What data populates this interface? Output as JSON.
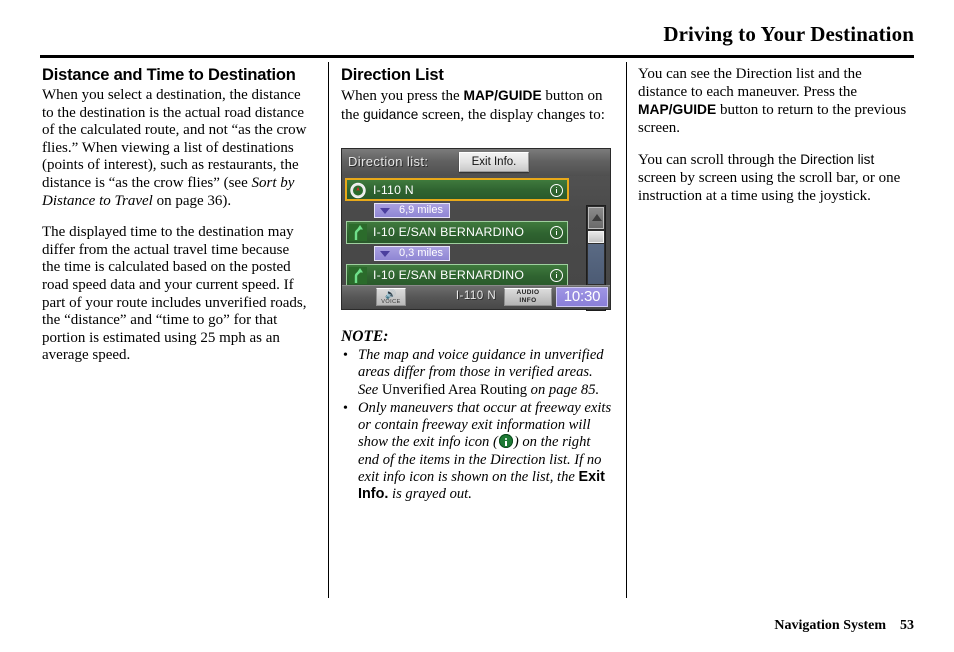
{
  "header": {
    "title": "Driving to Your Destination"
  },
  "footer": {
    "book_title": "Navigation System",
    "page_number": "53"
  },
  "column1": {
    "heading": "Distance and Time to Destination",
    "p1_a": "When you select a destination, the distance to the destination is the actual road distance of the calculated route, and not “as the crow flies.” When viewing a list of destinations (points of interest), such as restaurants, the distance is “as the crow flies” (see ",
    "p1_italic": "Sort by Distance to Travel",
    "p1_b": " on page 36).",
    "p2": "The displayed time to the destination may differ from the actual travel time because the time is calculated based on the posted road speed data and your current speed. If part of your route includes unverified roads, the “distance” and “time to go” for that portion is estimated using 25 mph as an average speed."
  },
  "column2": {
    "heading": "Direction List",
    "intro_a": "When you press the ",
    "intro_mapguide": "MAP/GUIDE",
    "intro_b": " button on the ",
    "intro_guidance": "guidance",
    "intro_c": " screen, the display changes to:",
    "note_title": "NOTE:",
    "note1_a": "The map and voice guidance in unverified areas differ from those in verified areas. See",
    "note1_ref": " Unverified Area Routing ",
    "note1_b": "on page 85.",
    "note2_a": "Only maneuvers that occur at freeway exits or contain freeway exit information will show the exit info icon (",
    "note2_b": ") on the right end of the items in the Direction list. If no exit info icon is shown on the list, the ",
    "note2_exitinfo": "Exit Info.",
    "note2_c": " is grayed out."
  },
  "column3": {
    "p1_a": "You can see the Direction list and the distance to each maneuver. Press the ",
    "p1_mapguide": "MAP/GUIDE",
    "p1_b": " button to return to the previous screen.",
    "p2_a": "You can scroll through the ",
    "p2_directionlist": "Direction list",
    "p2_b": " screen by screen using the scroll bar, or one instruction at a time using the joystick."
  },
  "nav_screen": {
    "title": "Direction list:",
    "exit_info_button": "Exit Info.",
    "rows": [
      {
        "label": "I-110 N",
        "icon": "compass-icon",
        "selected": true,
        "has_info": true
      },
      {
        "label": "I-10 E/SAN BERNARDINO",
        "icon": "fork-right-icon",
        "selected": false,
        "has_info": true
      },
      {
        "label": "I-10 E/SAN BERNARDINO",
        "icon": "fork-right-icon",
        "selected": false,
        "has_info": true
      }
    ],
    "distances": [
      "6,9 miles",
      "0,3 miles"
    ],
    "bottom_bar": {
      "voice_glyph": "🔊",
      "voice_label": "VOICE",
      "street": "I-110 N",
      "audio_line1": "AUDIO",
      "audio_line2": "INFO",
      "clock": "10:30"
    },
    "colors": {
      "row_green": "#2f6330",
      "selected_border": "#e8a91a",
      "distance_chip": "#8f86d4",
      "clock_bg": "#8a7fd8",
      "screen_bg": "#4a4a4a"
    }
  }
}
